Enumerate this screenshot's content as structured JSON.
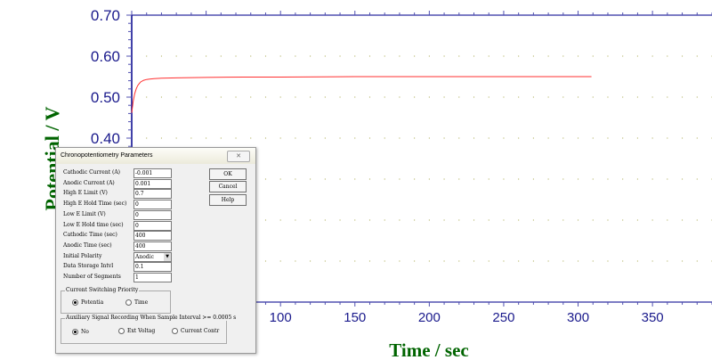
{
  "chart_data": {
    "type": "line",
    "xlabel": "Time / sec",
    "ylabel": "Potential / V",
    "xlim": [
      0,
      390
    ],
    "ylim": [
      0.0,
      0.7
    ],
    "x_ticks_visible": [
      100,
      150,
      200,
      250,
      300,
      350
    ],
    "y_ticks_visible": [
      "0.40",
      "0.50",
      "0.60",
      "0.70"
    ],
    "grid": true,
    "colors": {
      "line": "#ff3030",
      "axis": "#00008b",
      "ticks": "#5050b0",
      "axis_label": "#006400",
      "tick_label": "#1a1a8c",
      "grid": "#b0b060"
    },
    "series": [
      {
        "x": [
          0,
          1,
          2,
          3,
          4,
          5,
          6,
          8,
          10,
          12,
          15,
          20,
          30,
          50,
          75,
          100,
          150,
          200,
          250,
          309
        ],
        "y": [
          0.462,
          0.49,
          0.508,
          0.52,
          0.528,
          0.533,
          0.537,
          0.541,
          0.543,
          0.544,
          0.545,
          0.546,
          0.547,
          0.548,
          0.549,
          0.549,
          0.55,
          0.55,
          0.55,
          0.55
        ]
      }
    ]
  },
  "dialog": {
    "title": "Chronopotentiometry Parameters",
    "close_icon": "close-icon",
    "fields": [
      {
        "label": "Cathodic Current (A)",
        "value": "-0.001"
      },
      {
        "label": "Anodic Current (A)",
        "value": "0.001"
      },
      {
        "label": "High E Limit (V)",
        "value": "0.7"
      },
      {
        "label": "High E Hold Time (sec)",
        "value": "0"
      },
      {
        "label": "Low E Limit (V)",
        "value": "0"
      },
      {
        "label": "Low E Hold time (sec)",
        "value": "0"
      },
      {
        "label": "Cathodic Time (sec)",
        "value": "400"
      },
      {
        "label": "Anodic Time (sec)",
        "value": "400"
      },
      {
        "label": "Initial Polarity",
        "value": "Anodic"
      },
      {
        "label": "Data Storage Intvl",
        "value": "0.1"
      },
      {
        "label": "Number of Segments",
        "value": "1"
      }
    ],
    "buttons": {
      "ok": "OK",
      "cancel": "Cancel",
      "help": "Help"
    },
    "switching": {
      "title": "Current Switching Priority",
      "options": [
        "Potentia",
        "Time"
      ],
      "selected": "Potentia"
    },
    "auxiliary": {
      "title": "Auxiliary Signal Recording When Sample Interval >= 0.0005 s",
      "options": [
        "No",
        "Ext Voltag",
        "Current Contr"
      ],
      "selected": "No"
    }
  }
}
